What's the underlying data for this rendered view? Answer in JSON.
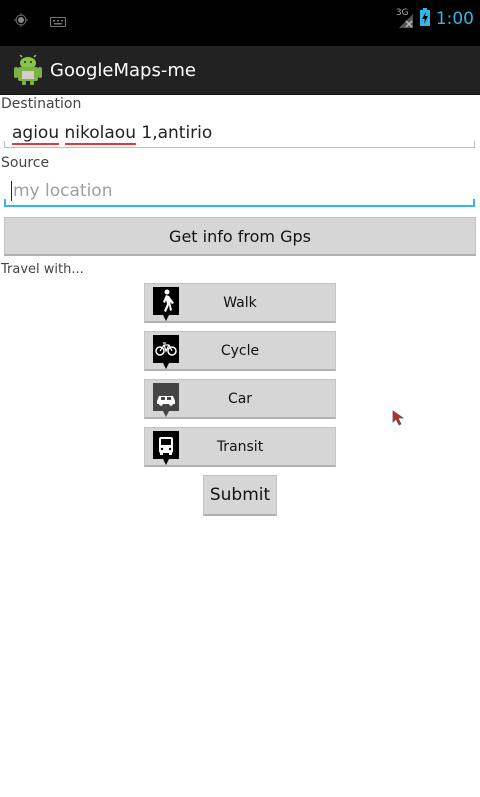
{
  "statusbar": {
    "network": "3G",
    "time": "1:00"
  },
  "app": {
    "title": "GoogleMaps-me"
  },
  "destination": {
    "label": "Destination",
    "word1": "agiou",
    "word2": "nikolaou",
    "rest": " 1,antirio"
  },
  "source": {
    "label": "Source",
    "placeholder": "my location"
  },
  "gps_button": {
    "label": "Get info from Gps"
  },
  "travel": {
    "label": "Travel with...",
    "modes": [
      {
        "label": "Walk",
        "icon": "walk-icon"
      },
      {
        "label": "Cycle",
        "icon": "bicycle-icon"
      },
      {
        "label": "Car",
        "icon": "car-icon"
      },
      {
        "label": "Transit",
        "icon": "bus-icon"
      }
    ]
  },
  "submit_button": {
    "label": "Submit"
  },
  "colors": {
    "accent": "#33b5e5",
    "actionbar": "#222222",
    "spellcheck": "#e53935",
    "button": "#d6d6d6"
  }
}
